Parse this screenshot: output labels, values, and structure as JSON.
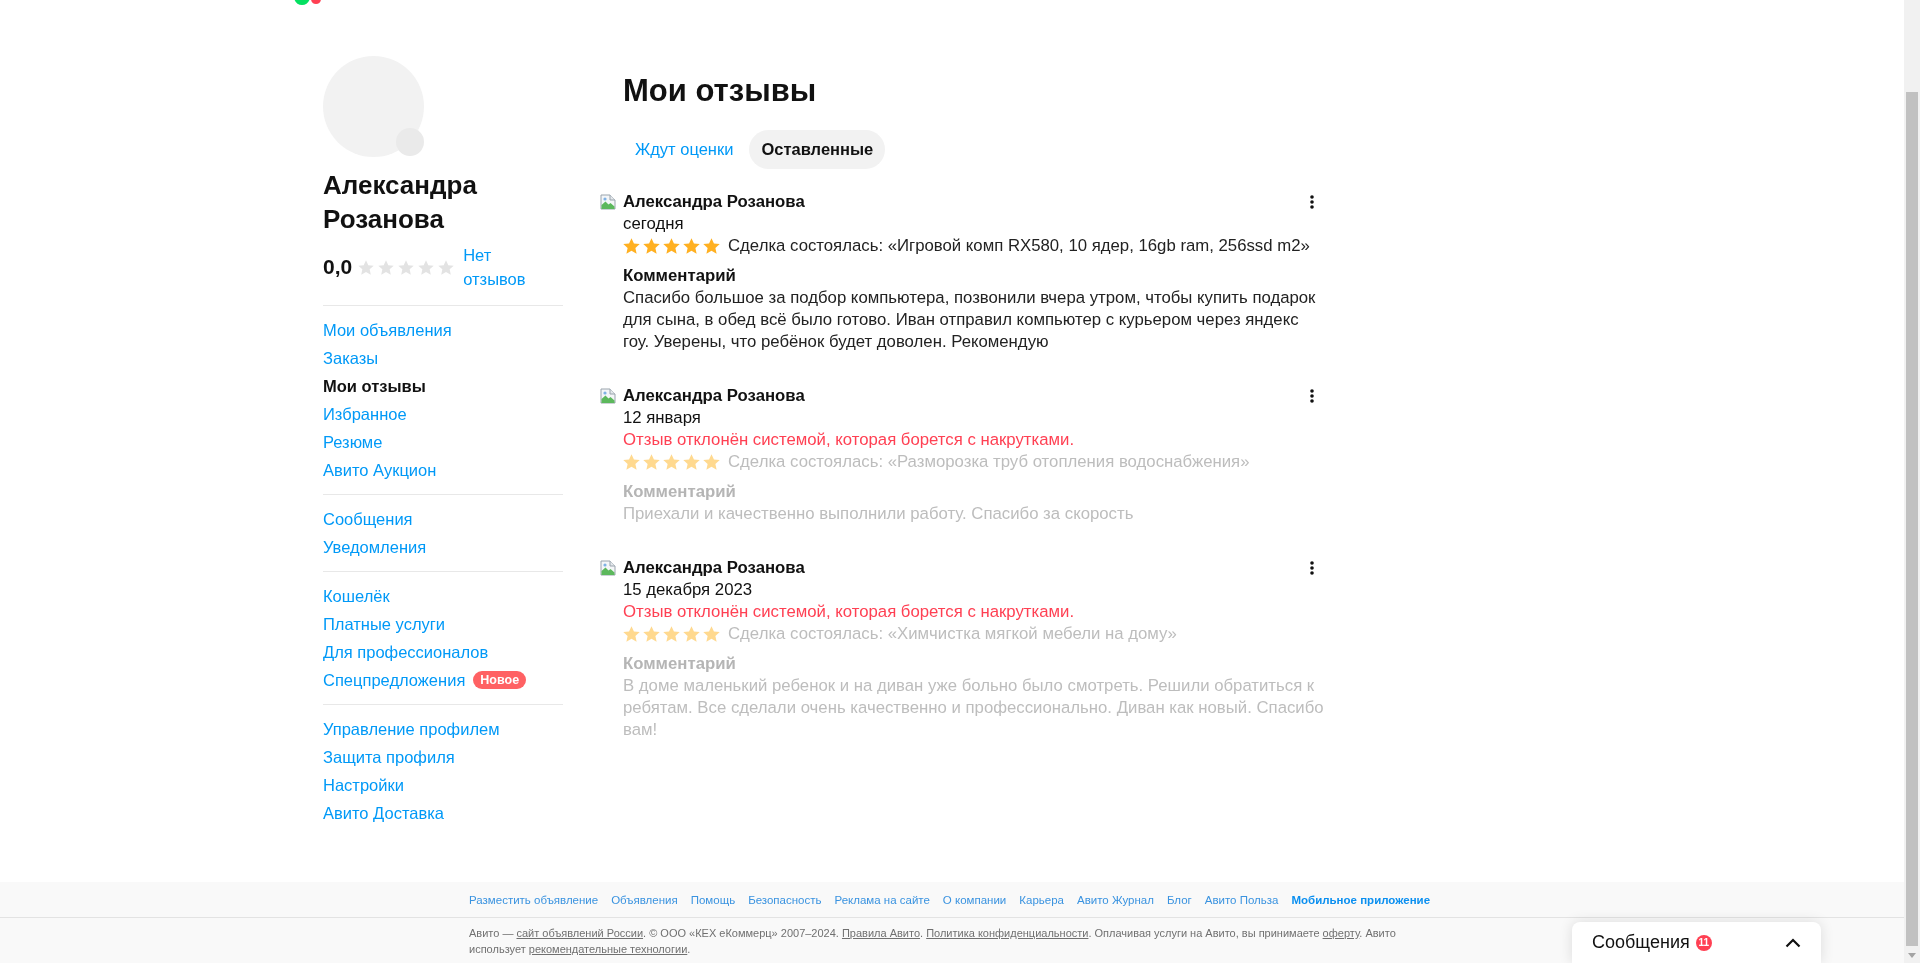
{
  "profile": {
    "name": "Александра Розанова",
    "rating": "0,0",
    "stars": 0,
    "reviews_link": "Нет отзывов"
  },
  "sidebar": {
    "groups": [
      {
        "items": [
          {
            "label": "Мои объявления",
            "selected": false
          },
          {
            "label": "Заказы",
            "selected": false
          },
          {
            "label": "Мои отзывы",
            "selected": true
          },
          {
            "label": "Избранное",
            "selected": false
          },
          {
            "label": "Резюме",
            "selected": false
          },
          {
            "label": "Авито Аукцион",
            "selected": false
          }
        ]
      },
      {
        "items": [
          {
            "label": "Сообщения",
            "selected": false
          },
          {
            "label": "Уведомления",
            "selected": false
          }
        ]
      },
      {
        "items": [
          {
            "label": "Кошелёк",
            "selected": false
          },
          {
            "label": "Платные услуги",
            "selected": false
          },
          {
            "label": "Для профессионалов",
            "selected": false
          },
          {
            "label": "Спецпредложения",
            "selected": false,
            "badge": "Новое"
          }
        ]
      },
      {
        "items": [
          {
            "label": "Управление профилем",
            "selected": false
          },
          {
            "label": "Защита профиля",
            "selected": false
          },
          {
            "label": "Настройки",
            "selected": false
          },
          {
            "label": "Авито Доставка",
            "selected": false
          }
        ]
      }
    ]
  },
  "page_title": "Мои отзывы",
  "tabs": [
    {
      "label": "Ждут оценки",
      "selected": false
    },
    {
      "label": "Оставленные",
      "selected": true
    }
  ],
  "reviews": [
    {
      "author": "Александра Розанова",
      "date": "сегодня",
      "rejected": false,
      "stars": 5,
      "deal": "Сделка состоялась: «Игровой комп RX580, 10 ядер, 16gb ram, 256ssd m2»",
      "comment_label": "Комментарий",
      "comment": "Спасибо большое за подбор компьютера, позвонили вчера утром, чтобы купить подарок для сына, в обед всё было готово. Иван отправил компьютер с курьером через яндекс гоу. Уверены, что ребёнок будет доволен. Рекомендую"
    },
    {
      "author": "Александра Розанова",
      "date": "12 января",
      "rejected": true,
      "status": "Отзыв отклонён системой, которая борется с накрутками.",
      "stars": 5,
      "deal": "Сделка состоялась: «Разморозка труб отопления водоснабжения»",
      "comment_label": "Комментарий",
      "comment": "Приехали и качественно выполнили работу. Спасибо за скорость"
    },
    {
      "author": "Александра Розанова",
      "date": "15 декабря 2023",
      "rejected": true,
      "status": "Отзыв отклонён системой, которая борется с накрутками.",
      "stars": 5,
      "deal": "Сделка состоялась: «Химчистка мягкой мебели на дому»",
      "comment_label": "Комментарий",
      "comment": "В доме маленький ребенок и на диван уже больно было смотреть. Решили обратиться к ребятам. Все сделали очень качественно и профессионально. Диван как новый. Спасибо вам!"
    }
  ],
  "footer": {
    "links": [
      {
        "label": "Разместить объявление",
        "emphasized": false
      },
      {
        "label": "Объявления",
        "emphasized": false
      },
      {
        "label": "Помощь",
        "emphasized": false
      },
      {
        "label": "Безопасность",
        "emphasized": false
      },
      {
        "label": "Реклама на сайте",
        "emphasized": false
      },
      {
        "label": "О компании",
        "emphasized": false
      },
      {
        "label": "Карьера",
        "emphasized": false
      },
      {
        "label": "Авито Журнал",
        "emphasized": false
      },
      {
        "label": "Блог",
        "emphasized": false
      },
      {
        "label": "Авито Польза",
        "emphasized": false
      },
      {
        "label": "Мобильное приложение",
        "emphasized": true
      }
    ],
    "copyright": [
      {
        "kind": "text",
        "text": "Авито — "
      },
      {
        "kind": "link",
        "text": "сайт объявлений России"
      },
      {
        "kind": "text",
        "text": ". © ООО «КЕХ еКоммерц» 2007–2024. "
      },
      {
        "kind": "link",
        "text": "Правила Авито"
      },
      {
        "kind": "text",
        "text": ". "
      },
      {
        "kind": "link",
        "text": "Политика конфиденциальности"
      },
      {
        "kind": "text",
        "text": ". Оплачивая услуги на Авито, вы принимаете "
      },
      {
        "kind": "link",
        "text": "оферту"
      },
      {
        "kind": "text",
        "text": ". Авито использует "
      },
      {
        "kind": "link",
        "text": "рекомендательные технологии"
      },
      {
        "kind": "text",
        "text": "."
      }
    ]
  },
  "messages_widget": {
    "label": "Сообщения",
    "badge": "11"
  }
}
